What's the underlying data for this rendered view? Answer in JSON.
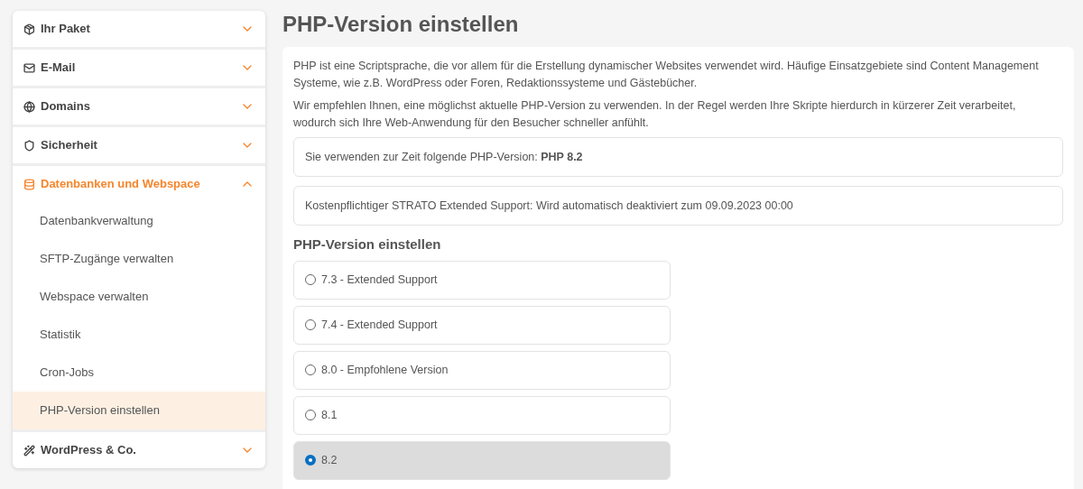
{
  "sidebar": {
    "sections": [
      {
        "label": "Ihr Paket",
        "expanded": false
      },
      {
        "label": "E-Mail",
        "expanded": false
      },
      {
        "label": "Domains",
        "expanded": false
      },
      {
        "label": "Sicherheit",
        "expanded": false
      },
      {
        "label": "Datenbanken und Webspace",
        "expanded": true,
        "children": [
          {
            "label": "Datenbankverwaltung",
            "selected": false
          },
          {
            "label": "SFTP-Zugänge verwalten",
            "selected": false
          },
          {
            "label": "Webspace verwalten",
            "selected": false
          },
          {
            "label": "Statistik",
            "selected": false
          },
          {
            "label": "Cron-Jobs",
            "selected": false
          },
          {
            "label": "PHP-Version einstellen",
            "selected": true
          }
        ]
      },
      {
        "label": "WordPress & Co.",
        "expanded": false
      }
    ]
  },
  "page_title": "PHP-Version einstellen",
  "intro": [
    "PHP ist eine Scriptsprache, die vor allem für die Erstellung dynamischer Websites verwendet wird. Häufige Einsatzgebiete sind Content Management Systeme, wie z.B. WordPress oder Foren, Redaktionssysteme und Gästebücher.",
    "Wir empfehlen Ihnen, eine möglichst aktuelle PHP-Version zu verwenden. In der Regel werden Ihre Skripte hierdurch in kürzerer Zeit verarbeitet, wodurch sich Ihre Web-Anwendung für den Besucher schneller anfühlt."
  ],
  "info_boxes": [
    "Sie verwenden zur Zeit folgende PHP-Version: **PHP 8.2**",
    "Kostenpflichtiger STRATO Extended Support: Wird automatisch deaktiviert zum 09.09.2023 00:00"
  ],
  "version_heading": "PHP-Version einstellen",
  "versions": [
    {
      "label": "7.3 - Extended Support",
      "selected": false
    },
    {
      "label": "7.4 - Extended Support",
      "selected": false
    },
    {
      "label": "8.0 - Empfohlene Version",
      "selected": false
    },
    {
      "label": "8.1",
      "selected": false
    },
    {
      "label": "8.2",
      "selected": true
    }
  ]
}
